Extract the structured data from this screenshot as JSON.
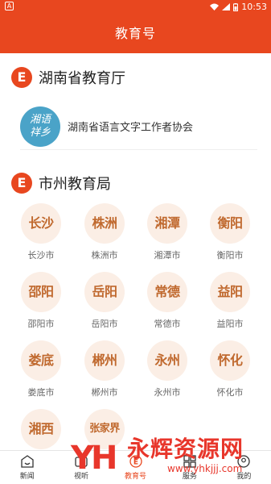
{
  "status_bar": {
    "left_badge": "A",
    "time": "10:53"
  },
  "header": {
    "title": "教育号"
  },
  "section_province": {
    "badge": "E",
    "title": "湖南省教育厅"
  },
  "province_orgs": [
    {
      "logo_text": "湘语\n祥乡",
      "name": "湖南省语言文字工作者协会"
    }
  ],
  "section_city": {
    "badge": "E",
    "title": "市州教育局"
  },
  "cities": [
    {
      "circle": "长沙",
      "name": "长沙市"
    },
    {
      "circle": "株洲",
      "name": "株洲市"
    },
    {
      "circle": "湘潭",
      "name": "湘潭市"
    },
    {
      "circle": "衡阳",
      "name": "衡阳市"
    },
    {
      "circle": "邵阳",
      "name": "邵阳市"
    },
    {
      "circle": "岳阳",
      "name": "岳阳市"
    },
    {
      "circle": "常德",
      "name": "常德市"
    },
    {
      "circle": "益阳",
      "name": "益阳市"
    },
    {
      "circle": "娄底",
      "name": "娄底市"
    },
    {
      "circle": "郴州",
      "name": "郴州市"
    },
    {
      "circle": "永州",
      "name": "永州市"
    },
    {
      "circle": "怀化",
      "name": "怀化市"
    },
    {
      "circle": "湘西",
      "name": ""
    },
    {
      "circle": "张家界",
      "name": ""
    }
  ],
  "tabs": [
    {
      "label": "新闻",
      "icon": "home-icon",
      "active": false
    },
    {
      "label": "视听",
      "icon": "video-icon",
      "active": false
    },
    {
      "label": "教育号",
      "icon": "education-icon",
      "active": true
    },
    {
      "label": "服务",
      "icon": "service-icon",
      "active": false
    },
    {
      "label": "我的",
      "icon": "profile-icon",
      "active": false
    }
  ],
  "watermark": {
    "logo": "YH",
    "text": "永辉资源网",
    "url": "www.yhkjjj.com"
  },
  "colors": {
    "brand": "#e8471f",
    "circle_bg": "#fbeee5",
    "circle_text": "#c0692e"
  }
}
